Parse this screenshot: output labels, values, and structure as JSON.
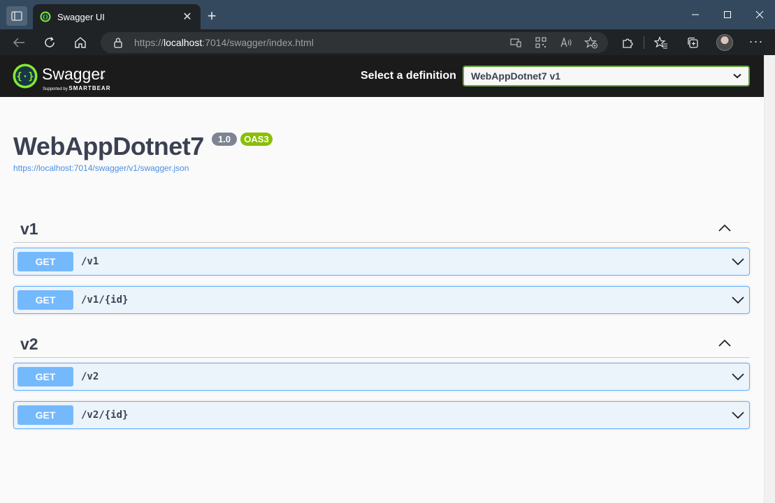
{
  "browser": {
    "tab_title": "Swagger UI",
    "url_prefix": "https://",
    "url_host": "localhost",
    "url_rest": ":7014/swagger/index.html"
  },
  "topbar": {
    "logo_name": "Swagger",
    "logo_sub_prefix": "Supported by",
    "logo_sub_brand": "SMARTBEAR",
    "definition_label": "Select a definition",
    "definition_selected": "WebAppDotnet7 v1"
  },
  "info": {
    "title": "WebAppDotnet7",
    "version": "1.0",
    "oas_badge": "OAS3",
    "spec_url": "https://localhost:7014/swagger/v1/swagger.json"
  },
  "tags": [
    {
      "name": "v1",
      "operations": [
        {
          "method": "GET",
          "path": "/v1"
        },
        {
          "method": "GET",
          "path": "/v1/{id}"
        }
      ]
    },
    {
      "name": "v2",
      "operations": [
        {
          "method": "GET",
          "path": "/v2"
        },
        {
          "method": "GET",
          "path": "/v2/{id}"
        }
      ]
    }
  ],
  "colors": {
    "get_method": "#61affe",
    "topbar_bg": "#1b1b1b",
    "select_border": "#62a03f",
    "oas_badge": "#89bf04",
    "version_badge": "#7d8492",
    "logo_green": "#85ea2d"
  }
}
